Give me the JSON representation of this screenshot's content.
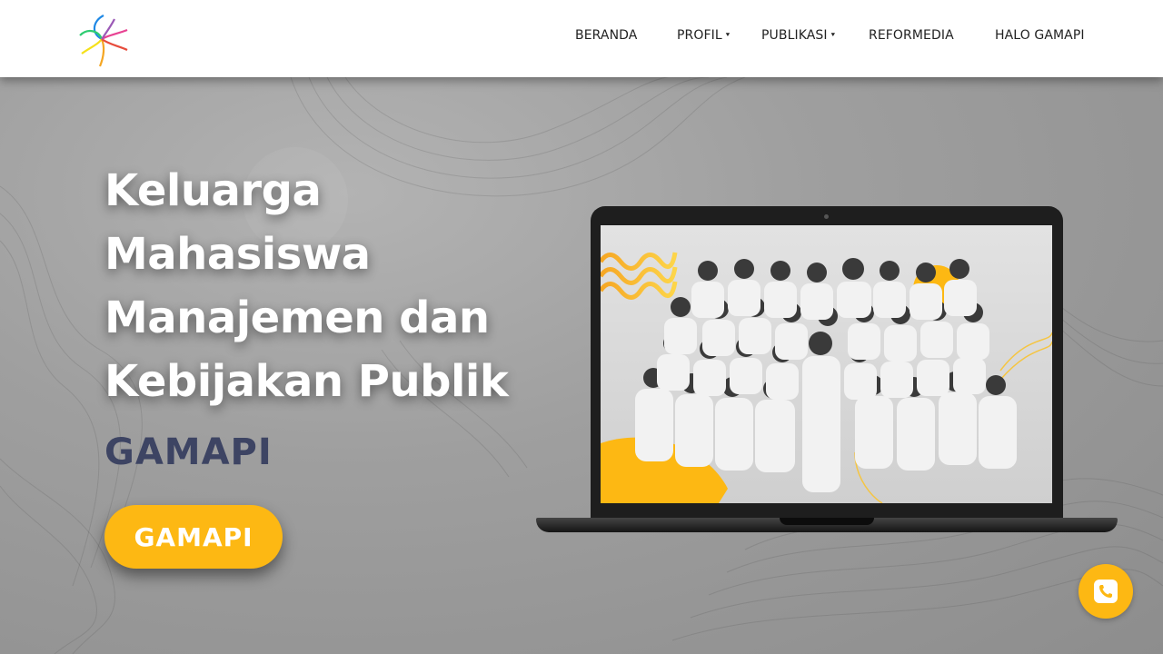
{
  "nav": {
    "items": [
      {
        "label": "BERANDA",
        "has_dropdown": false
      },
      {
        "label": "PROFIL",
        "has_dropdown": true
      },
      {
        "label": "PUBLIKASI",
        "has_dropdown": true
      },
      {
        "label": "REFORMEDIA",
        "has_dropdown": false
      },
      {
        "label": "HALO GAMAPI",
        "has_dropdown": false
      }
    ],
    "caret_glyph": "⯆",
    "logo_icon": "gamapi-logo-icon"
  },
  "hero": {
    "title": "Keluarga Mahasiswa Manajemen dan Kebijakan Publik",
    "subtitle": "GAMAPI",
    "cta_label": "GAMAPI",
    "image": "laptop-group-photo"
  },
  "fab": {
    "icon": "phone-icon"
  },
  "colors": {
    "accent": "#fdb813",
    "subtitle": "#3d4463",
    "header_bg": "#ffffff",
    "hero_bg": "#9f9f9f"
  }
}
